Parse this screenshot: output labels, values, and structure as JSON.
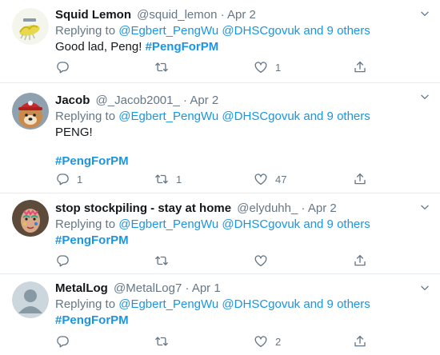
{
  "tweets": [
    {
      "name": "Squid Lemon",
      "handle": "@squid_lemon",
      "date": "Apr 2",
      "avatar": "squid-lemon-avatar",
      "replying_prefix": "Replying to",
      "mentions": [
        "@Egbert_PengWu",
        "@DHSCgovuk"
      ],
      "and_others": "and 9 others",
      "text": "Good lad, Peng!",
      "hashtag": "#PengForPM",
      "reply_count": "",
      "retweet_count": "",
      "like_count": "1"
    },
    {
      "name": "Jacob",
      "handle": "@_Jacob2001_",
      "date": "Apr 2",
      "avatar": "dog-avatar",
      "replying_prefix": "Replying to",
      "mentions": [
        "@Egbert_PengWu",
        "@DHSCgovuk"
      ],
      "and_others": "and 9 others",
      "text": "PENG!",
      "hashtag": "#PengForPM",
      "reply_count": "1",
      "retweet_count": "1",
      "like_count": "47"
    },
    {
      "name": "stop stockpiling - stay at home",
      "handle": "@elyduhh_",
      "date": "Apr 2",
      "avatar": "face-paint-avatar",
      "replying_prefix": "Replying to",
      "mentions": [
        "@Egbert_PengWu",
        "@DHSCgovuk"
      ],
      "and_others": "and 9 others",
      "text": "",
      "hashtag": "#PengForPM",
      "reply_count": "",
      "retweet_count": "",
      "like_count": ""
    },
    {
      "name": "MetalLog",
      "handle": "@MetalLog7",
      "date": "Apr 1",
      "avatar": "default-avatar",
      "replying_prefix": "Replying to",
      "mentions": [
        "@Egbert_PengWu",
        "@DHSCgovuk"
      ],
      "and_others": "and 9 others",
      "text": "",
      "hashtag": "#PengForPM",
      "reply_count": "",
      "retweet_count": "",
      "like_count": "2"
    }
  ],
  "separator": "·",
  "colors": {
    "link": "#1b95e0",
    "muted": "#657786",
    "text": "#14171a",
    "border": "#e6ecf0"
  }
}
